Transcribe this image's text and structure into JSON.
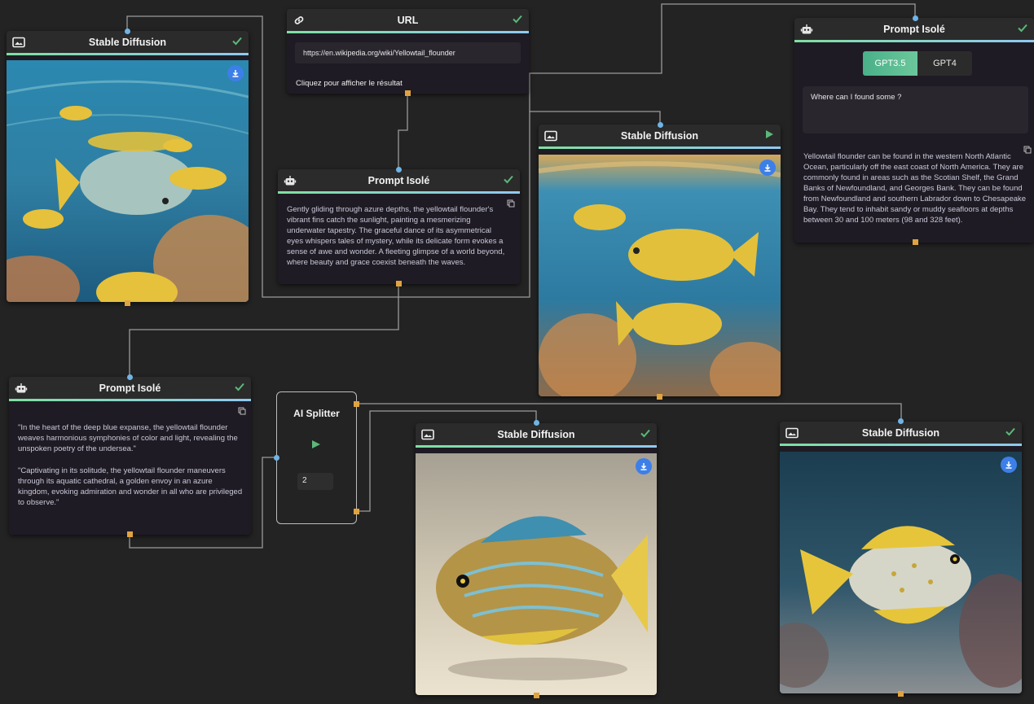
{
  "colors": {
    "background": "#232323",
    "node_body": "#1f1b24",
    "header_line_start": "#7ee0a1",
    "header_line_end": "#8fc9f2",
    "check": "#5cb87a",
    "port_out": "#e0a340",
    "port_in": "#6fb4e6",
    "download": "#3d7fe8",
    "toggle_active": "#49b089"
  },
  "nodes": {
    "sd1": {
      "title": "Stable Diffusion",
      "header_icon": "image-icon",
      "status": "check-icon"
    },
    "url": {
      "title": "URL",
      "header_icon": "link-icon",
      "status": "check-icon",
      "value": "https://en.wikipedia.org/wiki/Yellowtail_flounder",
      "link_label": "Cliquez pour afficher le résultat"
    },
    "prompt1": {
      "title": "Prompt Isolé",
      "header_icon": "robot-icon",
      "status": "check-icon",
      "text": "Gently gliding through azure depths, the yellowtail flounder's vibrant fins catch the sunlight, painting a mesmerizing underwater tapestry. The graceful dance of its asymmetrical eyes whispers tales of mystery, while its delicate form evokes a sense of awe and wonder. A fleeting glimpse of a world beyond, where beauty and grace coexist beneath the waves."
    },
    "sd2": {
      "title": "Stable Diffusion",
      "header_icon": "image-icon",
      "status": "play-icon"
    },
    "prompt2": {
      "title": "Prompt Isolé",
      "header_icon": "robot-icon",
      "status": "check-icon",
      "model_options": [
        "GPT3.5",
        "GPT4"
      ],
      "model_selected": "GPT3.5",
      "question": "Where can I found some ?",
      "answer": "Yellowtail flounder can be found in the western North Atlantic Ocean, particularly off the east coast of North America. They are commonly found in areas such as the Scotian Shelf, the Grand Banks of Newfoundland, and Georges Bank. They can be found from Newfoundland and southern Labrador down to Chesapeake Bay. They tend to inhabit sandy or muddy seafloors at depths between 30 and 100 meters (98 and 328 feet)."
    },
    "prompt3": {
      "title": "Prompt Isolé",
      "header_icon": "robot-icon",
      "status": "check-icon",
      "paragraph1": "\"In the heart of the deep blue expanse, the yellowtail flounder weaves harmonious symphonies of color and light, revealing the unspoken poetry of the undersea.\"",
      "paragraph2": "\"Captivating in its solitude, the yellowtail flounder maneuvers through its aquatic cathedral, a golden envoy in an azure kingdom, evoking admiration and wonder in all who are privileged to observe.\""
    },
    "splitter": {
      "title": "AI Splitter",
      "run_icon": "play-icon",
      "count": "2"
    },
    "sd3": {
      "title": "Stable Diffusion",
      "header_icon": "image-icon",
      "status": "check-icon"
    },
    "sd4": {
      "title": "Stable Diffusion",
      "header_icon": "image-icon",
      "status": "check-icon"
    }
  }
}
